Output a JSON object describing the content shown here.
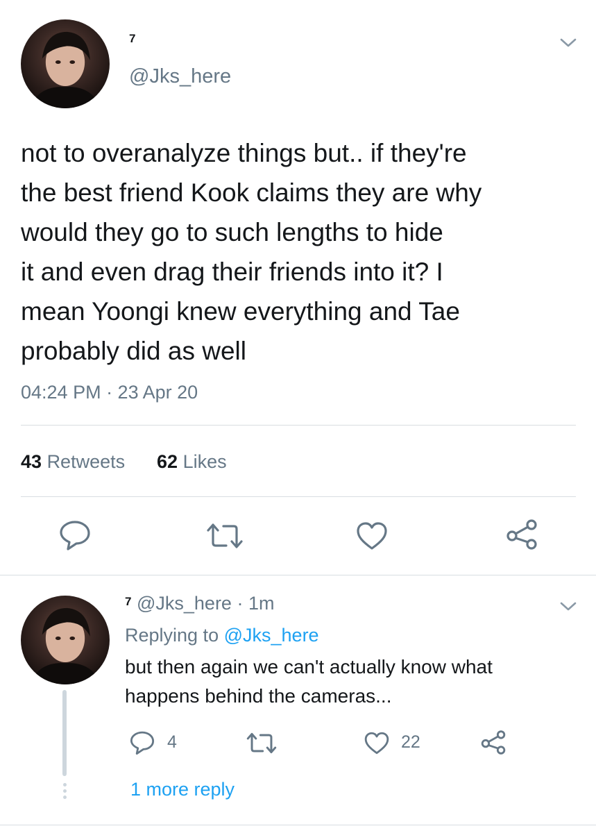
{
  "tweet": {
    "display_name": "7",
    "handle": "@Jks_here",
    "text_lines": [
      "not to overanalyze things but.. if they're",
      "the best friend Kook claims they are why",
      "would they go to such lengths to hide",
      "it and even drag their friends into it? I",
      "mean Yoongi knew everything and Tae",
      "probably did as well"
    ],
    "timestamp": "04:24 PM · 23 Apr 20",
    "retweets_count": "43",
    "retweets_label": "Retweets",
    "likes_count": "62",
    "likes_label": "Likes"
  },
  "reply": {
    "display_name": "7",
    "handle": "@Jks_here",
    "time": "· 1m",
    "replying_prefix": "Replying to",
    "replying_handle": "@Jks_here",
    "text_lines": [
      "but then again we can't actually know what",
      "happens behind the cameras..."
    ],
    "reply_count": "4",
    "like_count": "22",
    "more_replies": "1 more reply"
  },
  "colors": {
    "link": "#1da1f2",
    "muted": "#657786",
    "icon": "#657786",
    "divider": "#d8dde1"
  },
  "icons": [
    "chevron-down-icon",
    "reply-icon",
    "retweet-icon",
    "like-icon",
    "share-icon"
  ]
}
